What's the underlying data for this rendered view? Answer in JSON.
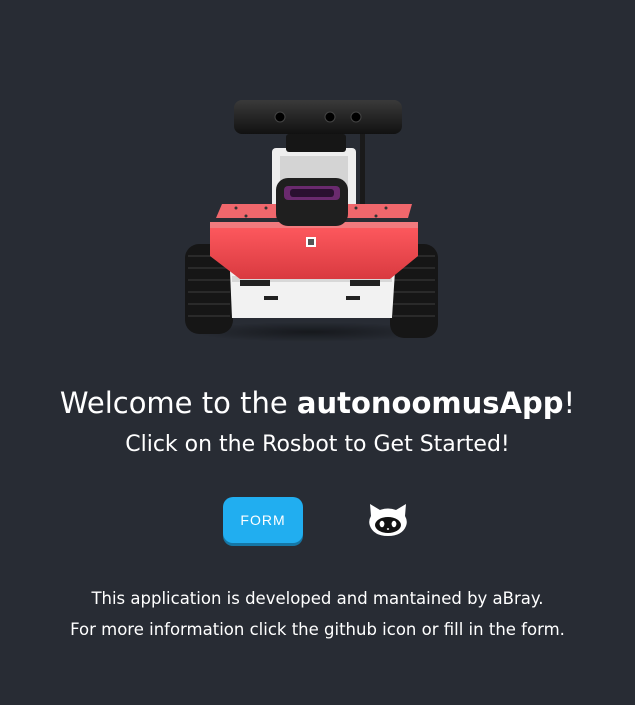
{
  "hero": {
    "image_name": "rosbot-robot-image"
  },
  "welcome": {
    "prefix": "Welcome to the ",
    "app_name": "autonoomusApp",
    "suffix": "!"
  },
  "subtitle": "Click on the Rosbot to Get Started!",
  "actions": {
    "form_label": "FORM",
    "github_icon": "github-octocat-icon"
  },
  "footer": {
    "line1": "This application is developed and mantained by aBray.",
    "line2": "For more information click the github icon or fill in the form."
  },
  "colors": {
    "background": "#282c34",
    "button": "#21aef0",
    "robot_body": "#e8474c"
  }
}
